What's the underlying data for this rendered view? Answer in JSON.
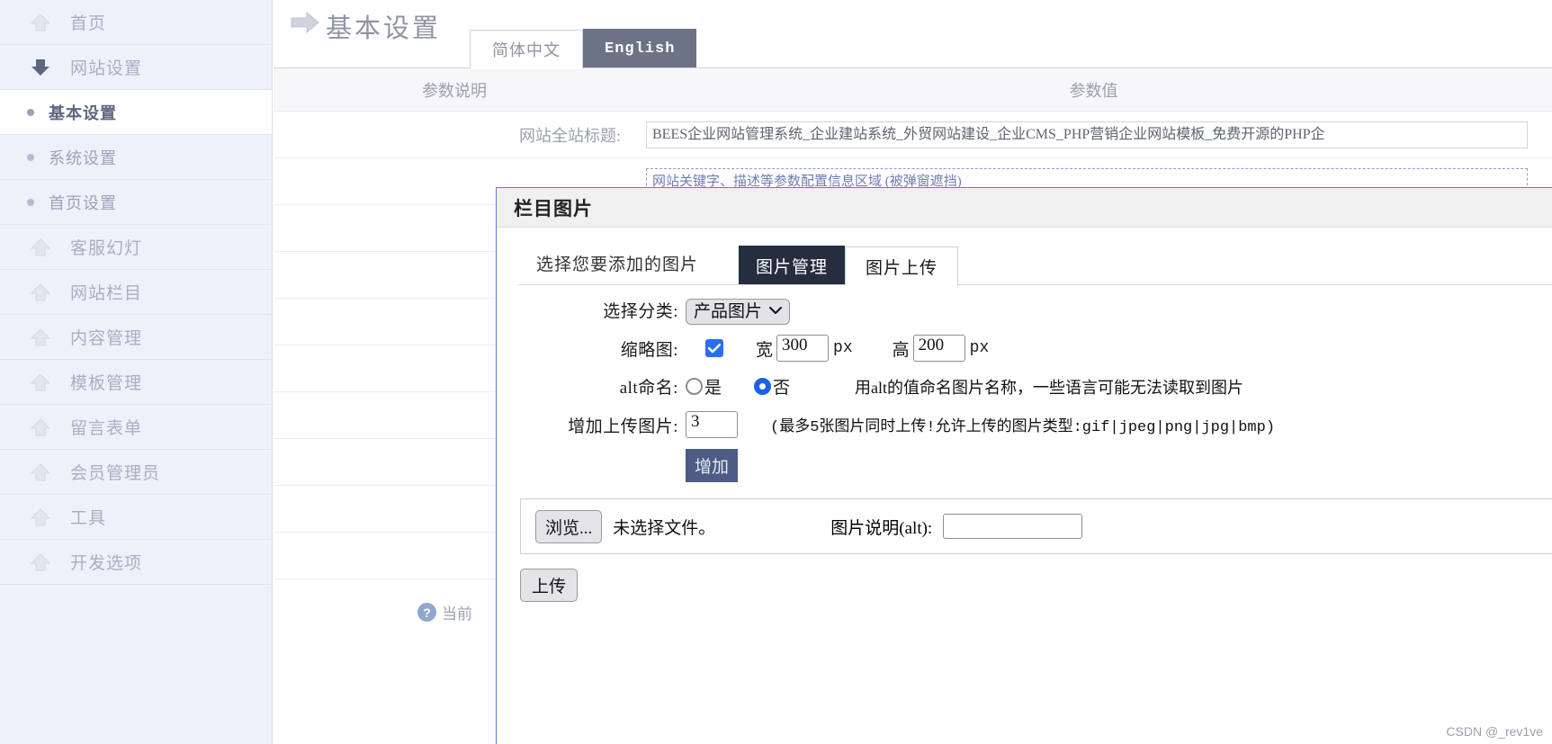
{
  "sidebar": {
    "items": [
      {
        "label": "首页",
        "icon": "up-arrow-icon",
        "type": "group",
        "active": false
      },
      {
        "label": "网站设置",
        "icon": "down-arrow-icon",
        "type": "group",
        "active": false
      },
      {
        "label": "基本设置",
        "icon": "bullet-icon",
        "type": "sub",
        "active": true
      },
      {
        "label": "系统设置",
        "icon": "bullet-icon",
        "type": "sub",
        "active": false
      },
      {
        "label": "首页设置",
        "icon": "bullet-icon",
        "type": "sub",
        "active": false
      },
      {
        "label": "客服幻灯",
        "icon": "up-arrow-icon",
        "type": "group",
        "active": false
      },
      {
        "label": "网站栏目",
        "icon": "up-arrow-icon",
        "type": "group",
        "active": false
      },
      {
        "label": "内容管理",
        "icon": "up-arrow-icon",
        "type": "group",
        "active": false
      },
      {
        "label": "模板管理",
        "icon": "up-arrow-icon",
        "type": "group",
        "active": false
      },
      {
        "label": "留言表单",
        "icon": "up-arrow-icon",
        "type": "group",
        "active": false
      },
      {
        "label": "会员管理员",
        "icon": "up-arrow-icon",
        "type": "group",
        "active": false
      },
      {
        "label": "工具",
        "icon": "up-arrow-icon",
        "type": "group",
        "active": false
      },
      {
        "label": "开发选项",
        "icon": "up-arrow-icon",
        "type": "group",
        "active": false
      }
    ]
  },
  "page": {
    "title": "基本设置",
    "title_icon": "right-arrow-icon",
    "tabs": [
      {
        "label": "简体中文",
        "active": true
      },
      {
        "label": "English",
        "active": false
      }
    ],
    "table_headers": [
      "参数说明",
      "参数值"
    ],
    "rows": [
      {
        "label": "网站全站标题:",
        "value": "BEES企业网站管理系统_企业建站系统_外贸网站建设_企业CMS_PHP营销企业网站模板_免费开源的PHP企"
      },
      {
        "label": "",
        "value": "网站关键字、描述等参数配置信息区域 (被弹窗遮挡)"
      }
    ],
    "help_text": "当前"
  },
  "modal": {
    "title": "栏目图片",
    "intro": "选择您要添加的图片",
    "tabs": [
      {
        "label": "图片管理",
        "active": false,
        "style": "dark"
      },
      {
        "label": "图片上传",
        "active": true,
        "style": "light"
      }
    ],
    "category": {
      "label": "选择分类:",
      "value": "产品图片",
      "options": [
        "产品图片"
      ],
      "chevron": "chevron-down-icon"
    },
    "thumbnail": {
      "label": "缩略图:",
      "checked": true,
      "width_label": "宽",
      "width_value": "300",
      "width_unit": "px",
      "height_label": "高",
      "height_value": "200",
      "height_unit": "px"
    },
    "alt_naming": {
      "label": "alt命名:",
      "yes_label": "是",
      "no_label": "否",
      "selected": "否",
      "hint": "用alt的值命名图片名称，一些语言可能无法读取到图片"
    },
    "add_upload": {
      "label": "增加上传图片:",
      "value": "3",
      "hint": "(最多5张图片同时上传!允许上传的图片类型:gif|jpeg|png|jpg|bmp)",
      "button_label": "增加"
    },
    "file_row": {
      "browse_label": "浏览...",
      "no_file_text": "未选择文件。",
      "alt_label": "图片说明(alt):",
      "alt_value": ""
    },
    "upload_button": "上传"
  },
  "watermark": "CSDN @_rev1ve",
  "colors": {
    "sidebar_bg": "#eef1fa",
    "modal_border": "#5b7fd4",
    "tab_dark": "#252d3f",
    "tab_gray": "#6d7387",
    "accent_blue": "#2a6ef5",
    "add_button": "#4e5b84"
  }
}
